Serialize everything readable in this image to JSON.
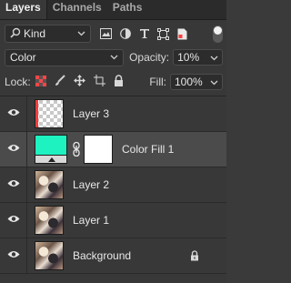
{
  "tabs": [
    {
      "label": "Layers",
      "active": true
    },
    {
      "label": "Channels",
      "active": false
    },
    {
      "label": "Paths",
      "active": false
    }
  ],
  "filter": {
    "kind_label": "Kind",
    "icons": [
      "pixel-filter-icon",
      "adjustment-filter-icon",
      "type-filter-icon",
      "shape-filter-icon",
      "smart-object-filter-icon"
    ],
    "toggle": "on"
  },
  "blend": {
    "mode": "Color",
    "opacity_label": "Opacity:",
    "opacity_value": "10%"
  },
  "lock": {
    "label": "Lock:",
    "icons": [
      "lock-transparent-icon",
      "lock-image-icon",
      "lock-position-icon",
      "lock-artboard-icon",
      "lock-all-icon"
    ],
    "fill_label": "Fill:",
    "fill_value": "100%"
  },
  "layers": [
    {
      "name": "Layer 3",
      "thumb": "transparent",
      "visible": true,
      "selected": false,
      "locked": false
    },
    {
      "name": "Color Fill 1",
      "thumb": "color-fill",
      "fill_color": "#1ef2c1",
      "visible": true,
      "selected": true,
      "locked": false
    },
    {
      "name": "Layer 2",
      "thumb": "photo",
      "visible": true,
      "selected": false,
      "locked": false
    },
    {
      "name": "Layer 1",
      "thumb": "photo",
      "visible": true,
      "selected": false,
      "locked": false
    },
    {
      "name": "Background",
      "thumb": "photo",
      "visible": true,
      "selected": false,
      "locked": true
    }
  ],
  "colors": {
    "panel_bg": "#383838",
    "tab_bar": "#2b2b2b",
    "selected_row": "#4b4b4b",
    "fill_swatch": "#1ef2c1"
  }
}
